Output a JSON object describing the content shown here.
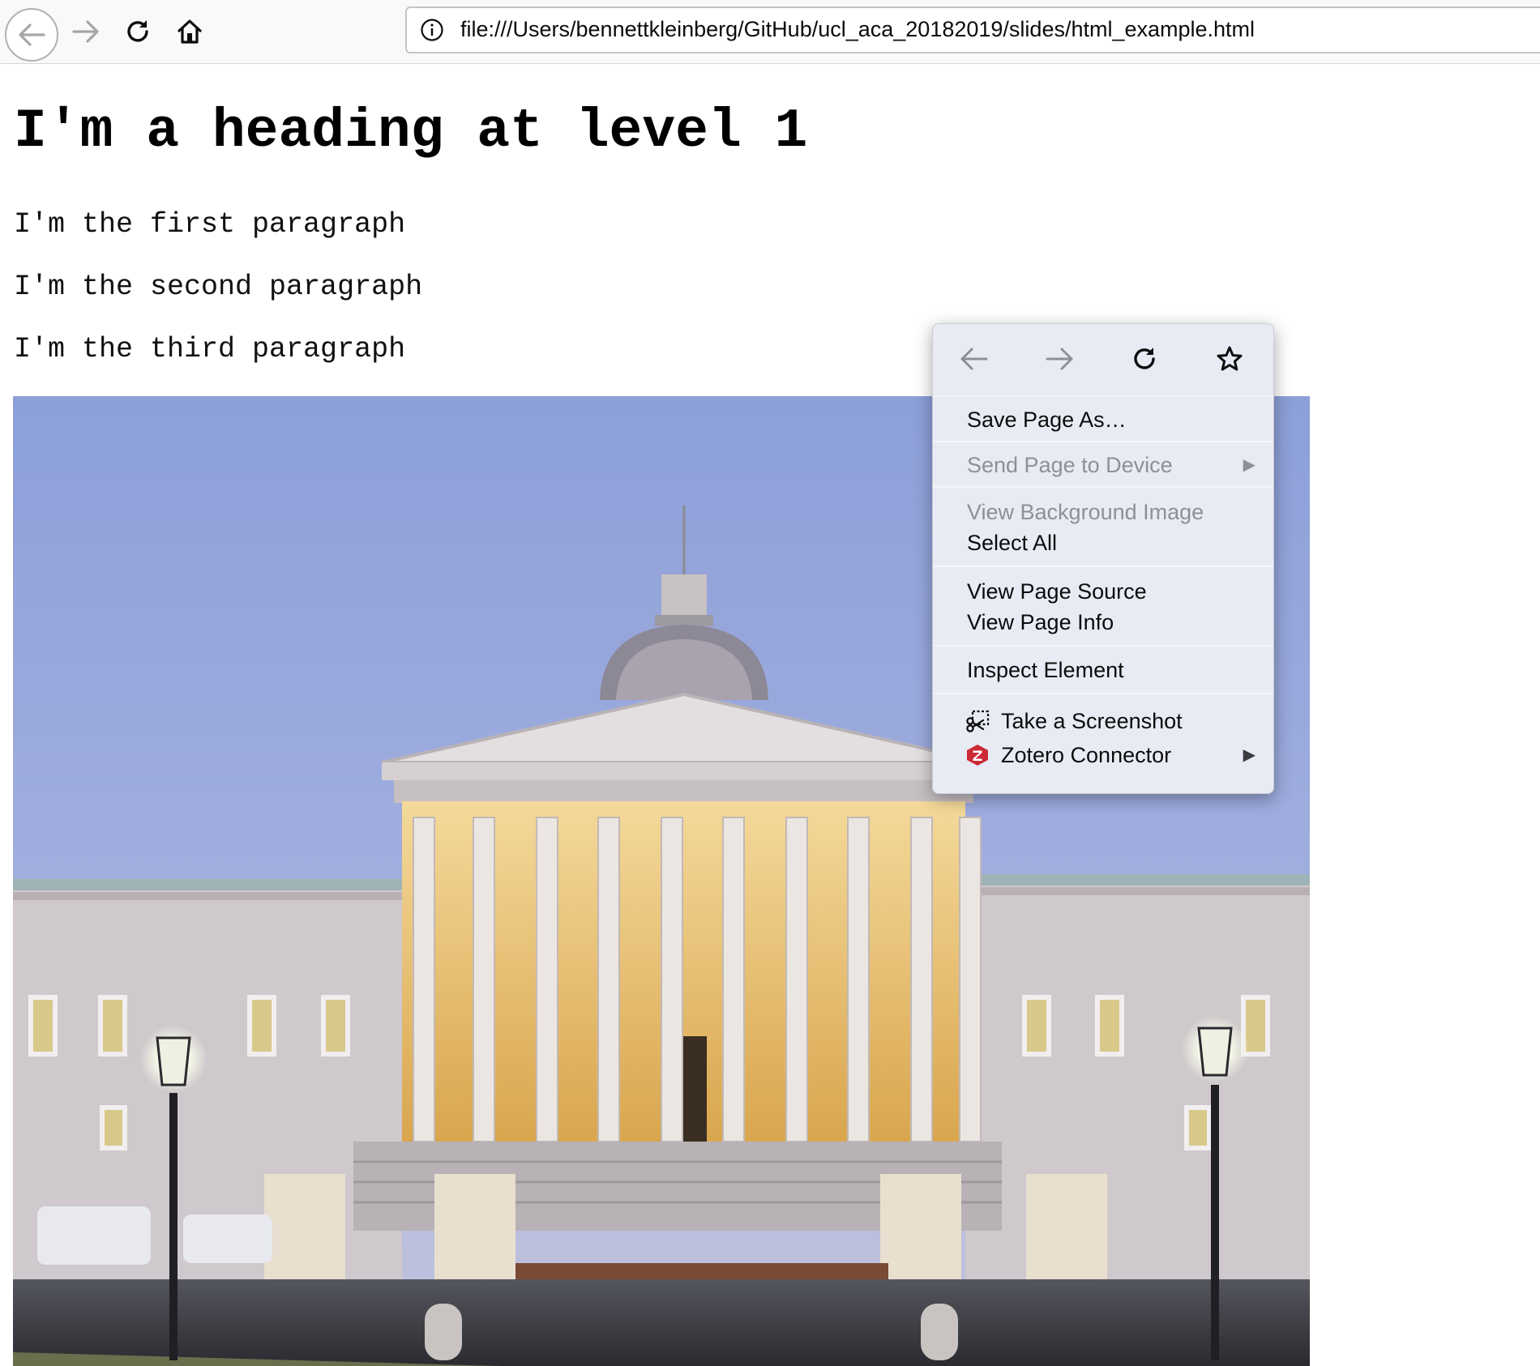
{
  "browser": {
    "url": "file:///Users/bennettkleinberg/GitHub/ucl_aca_20182019/slides/html_example.html",
    "icons": [
      "back-arrow-icon",
      "forward-arrow-icon",
      "reload-icon",
      "home-icon",
      "info-icon"
    ]
  },
  "page": {
    "heading": "I'm a heading at level 1",
    "paragraphs": [
      "I'm the first paragraph",
      "I'm the second paragraph",
      "I'm the third paragraph"
    ],
    "image": {
      "subject": "neoclassical building with columned portico and dome at dusk",
      "icon": "building-photo"
    }
  },
  "context_menu": {
    "nav_icons": [
      "back-arrow-icon",
      "forward-arrow-icon",
      "reload-icon",
      "bookmark-star-icon"
    ],
    "items": {
      "save_page_as": "Save Page As…",
      "send_page_to_device": "Send Page to Device",
      "view_background_image": "View Background Image",
      "select_all": "Select All",
      "view_page_source": "View Page Source",
      "view_page_info": "View Page Info",
      "inspect_element": "Inspect Element",
      "take_screenshot": "Take a Screenshot",
      "zotero_connector": "Zotero Connector"
    },
    "colors": {
      "menu_bg": "#e8ebf4",
      "disabled_text": "#8f9096",
      "zotero_red": "#cc2936"
    }
  }
}
